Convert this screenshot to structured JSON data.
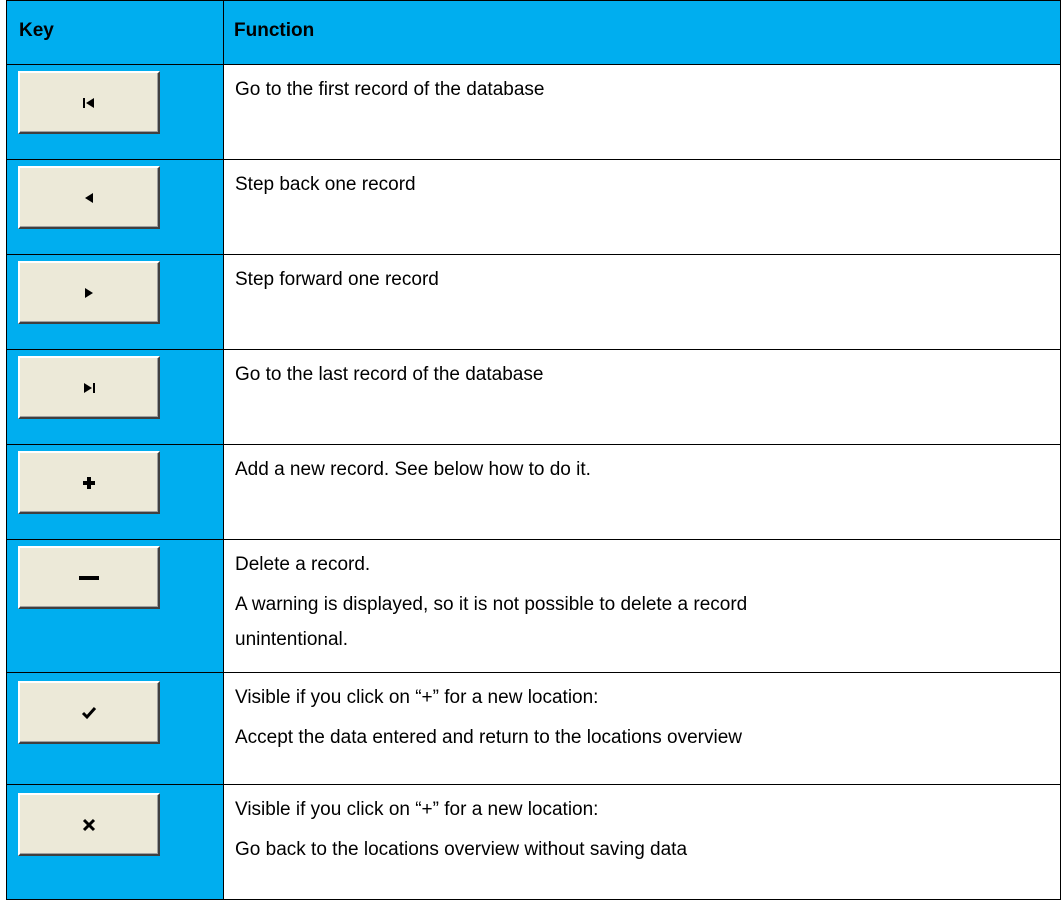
{
  "table": {
    "headers": {
      "key": "Key",
      "function": "Function"
    },
    "rows": [
      {
        "key_icon": "first-record-icon",
        "lines": [
          "Go to the first record of the database"
        ]
      },
      {
        "key_icon": "previous-record-icon",
        "lines": [
          "Step back one record"
        ]
      },
      {
        "key_icon": "next-record-icon",
        "lines": [
          "Step forward one record"
        ]
      },
      {
        "key_icon": "last-record-icon",
        "lines": [
          "Go to the last record of the database"
        ]
      },
      {
        "key_icon": "plus-icon",
        "lines": [
          "Add a new record. See below how to do it."
        ]
      },
      {
        "key_icon": "minus-icon",
        "lines": [
          "Delete a record.",
          "A warning is displayed, so it is not possible to delete a record",
          "unintentional."
        ]
      },
      {
        "key_icon": "check-icon",
        "lines": [
          "Visible if you click on “+” for a new location:",
          "Accept the data entered and return to the locations overview"
        ]
      },
      {
        "key_icon": "cross-icon",
        "lines": [
          "Visible if you click on “+” for a new location:",
          "Go back to the locations overview without saving data"
        ]
      }
    ]
  },
  "colors": {
    "header_and_key_column": "#00AEEF",
    "button_face": "#ECE9D8"
  }
}
